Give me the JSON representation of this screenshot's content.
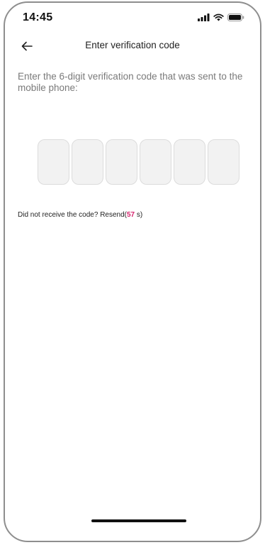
{
  "status_bar": {
    "time": "14:45",
    "icons": [
      "signal-icon",
      "wifi-icon",
      "battery-icon"
    ]
  },
  "header": {
    "back_icon": "arrow-left-icon",
    "title": "Enter verification code"
  },
  "main": {
    "instruction": "Enter the 6-digit verification code that was sent to the mobile phone:",
    "code_boxes": [
      "",
      "",
      "",
      "",
      "",
      ""
    ],
    "resend": {
      "prompt": "Did not receive the code?",
      "label": "Resend(",
      "countdown": "57",
      "unit": " s)"
    }
  },
  "colors": {
    "accent": "#d6246e",
    "box_fill": "#f2f2f2",
    "muted_text": "#7a7a7a"
  }
}
